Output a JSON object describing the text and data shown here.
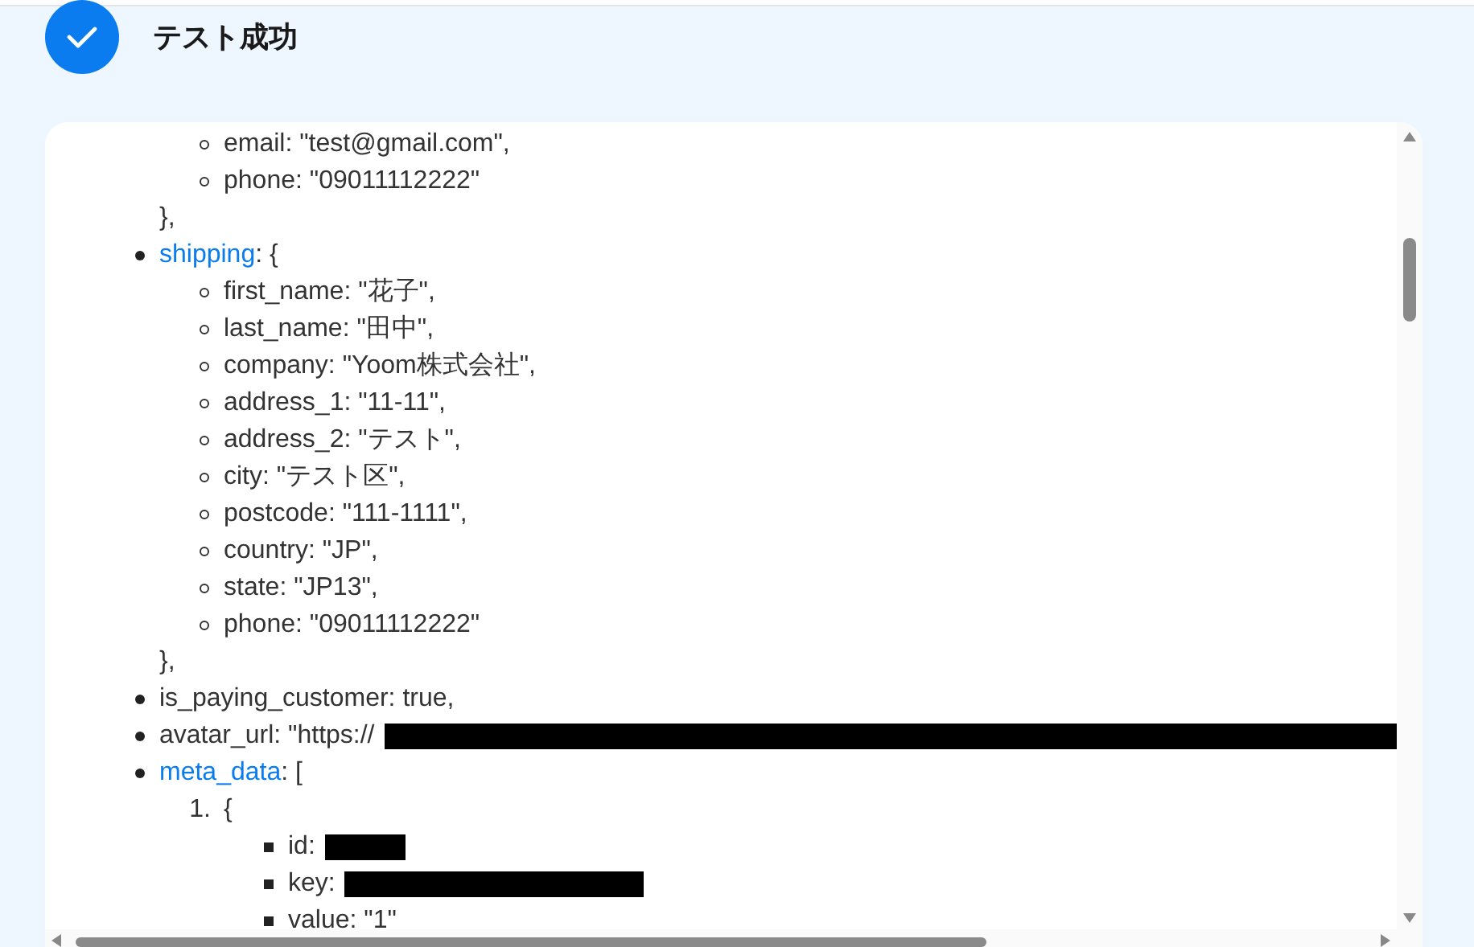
{
  "header": {
    "title": "テスト成功"
  },
  "tree": [
    {
      "children": [
        {
          "text": "email: \"test@gmail.com\","
        },
        {
          "text": "phone: \"09011112222\""
        }
      ],
      "closing": "},"
    },
    {
      "key": "shipping",
      "linked": true,
      "text": ": {",
      "children": [
        {
          "text": "first_name: \"花子\","
        },
        {
          "text": "last_name: \"田中\","
        },
        {
          "text": "company: \"Yoom株式会社\","
        },
        {
          "text": "address_1: \"11-11\","
        },
        {
          "text": "address_2: \"テスト\","
        },
        {
          "text": "city: \"テスト区\","
        },
        {
          "text": "postcode: \"111-1111\","
        },
        {
          "text": "country: \"JP\","
        },
        {
          "text": "state: \"JP13\","
        },
        {
          "text": "phone: \"09011112222\""
        }
      ],
      "closing": "},"
    },
    {
      "text": "is_paying_customer: true,"
    },
    {
      "text": "avatar_url: \"https://",
      "redacted": true
    },
    {
      "key": "meta_data",
      "linked": true,
      "text": ": [",
      "ordered": true,
      "children": [
        {
          "number": "1.",
          "text": "{",
          "children": [
            {
              "text": "id:",
              "redacted": true
            },
            {
              "text": "key:",
              "redacted": true
            },
            {
              "text": "value: \"1\""
            }
          ]
        }
      ]
    }
  ]
}
